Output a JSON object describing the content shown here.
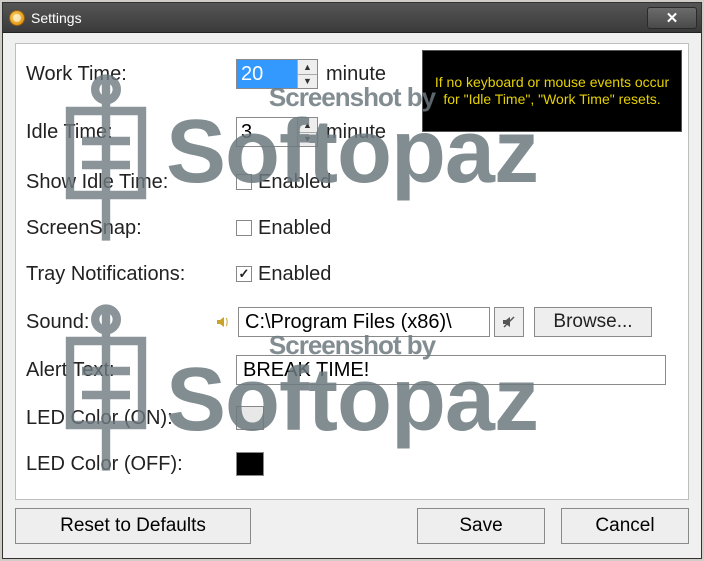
{
  "window": {
    "title": "Settings"
  },
  "tooltip": "If no keyboard or mouse events occur for \"Idle Time\", \"Work Time\" resets.",
  "fields": {
    "workTime": {
      "label": "Work Time:",
      "value": "20",
      "unit": "minute"
    },
    "idleTime": {
      "label": "Idle Time:",
      "value": "3",
      "unit": "minute"
    },
    "showIdle": {
      "label": "Show Idle Time:",
      "text": "Enabled",
      "checked": false
    },
    "screenSnap": {
      "label": "ScreenSnap:",
      "text": "Enabled",
      "checked": false
    },
    "trayNotif": {
      "label": "Tray Notifications:",
      "text": "Enabled",
      "checked": true
    },
    "sound": {
      "label": "Sound:",
      "value": "C:\\Program Files (x86)\\",
      "browse": "Browse..."
    },
    "alertText": {
      "label": "Alert Text:",
      "value": "BREAK TIME!"
    },
    "ledOn": {
      "label": "LED Color (ON):",
      "color": "#e8e8e8"
    },
    "ledOff": {
      "label": "LED Color (OFF):",
      "color": "#000000"
    }
  },
  "buttons": {
    "reset": "Reset to Defaults",
    "save": "Save",
    "cancel": "Cancel"
  },
  "watermark": {
    "small": "Screenshot by",
    "big": "Softopaz"
  }
}
